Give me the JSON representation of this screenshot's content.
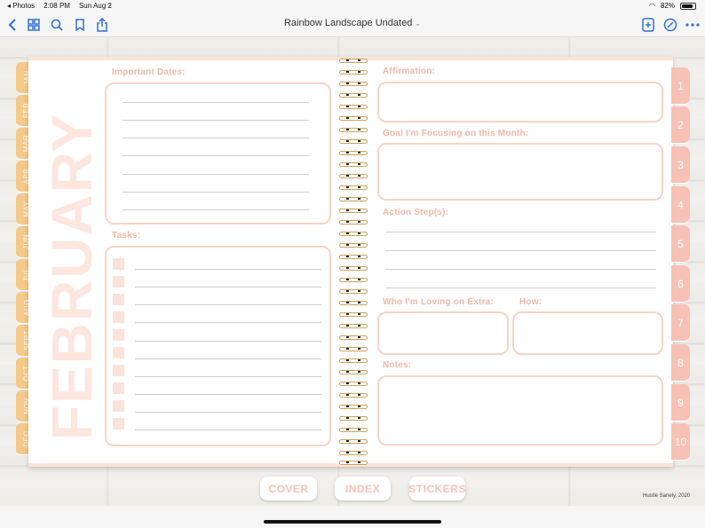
{
  "status_bar": {
    "back_app": "◂ Photos",
    "time": "2:08 PM",
    "date": "Sun Aug 2",
    "battery": "82%"
  },
  "toolbar": {
    "title": "Rainbow Landscape Undated",
    "title_chevron": "⌄",
    "icons": [
      "back-chevron",
      "grid",
      "search",
      "bookmark",
      "share",
      "add-page",
      "markup-pen",
      "more"
    ]
  },
  "planner": {
    "month_word": "FEBRUARY",
    "months": [
      "JAN",
      "FEB",
      "MAR",
      "APR",
      "MAY",
      "JUN",
      "JUL",
      "AUG",
      "SEPT",
      "OCT",
      "NOV",
      "DEC"
    ],
    "days": [
      "1",
      "2",
      "3",
      "4",
      "5",
      "6",
      "7",
      "8",
      "9",
      "10"
    ],
    "left": {
      "important_dates": "Important Dates:",
      "tasks": "Tasks:"
    },
    "right": {
      "affirmation": "Affirmation:",
      "goal": "Goal I'm Focusing on this Month:",
      "action_steps": "Action Step(s):",
      "loving_extra": "Who I'm Loving on Extra:",
      "how": "How:",
      "notes": "Notes:"
    }
  },
  "nav": {
    "cover": "COVER",
    "index": "INDEX",
    "stickers": "STICKERS"
  },
  "credit": "Hustle Sanely, 2020",
  "colors": {
    "accent_blue": "#2f6fd6",
    "month_tab": "#f4c989",
    "day_tab": "#f7c1b5",
    "box_border": "#f8d3c5",
    "label": "#f2b7a5"
  }
}
